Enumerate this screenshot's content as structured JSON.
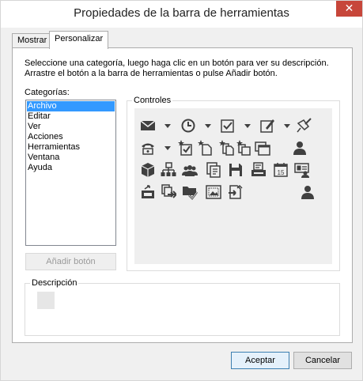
{
  "window": {
    "title": "Propiedades de la barra de herramientas",
    "close_glyph": "✕"
  },
  "tabs": [
    {
      "label": "Mostrar",
      "active": false
    },
    {
      "label": "Personalizar",
      "active": true
    }
  ],
  "instructions": {
    "line1": "Seleccione una categoría, luego haga clic en un botón para ver su descripción.",
    "line2": "Arrastre el botón a la barra de herramientas o pulse Añadir botón."
  },
  "categories": {
    "label": "Categorías:",
    "items": [
      "Archivo",
      "Editar",
      "Ver",
      "Acciones",
      "Herramientas",
      "Ventana",
      "Ayuda"
    ],
    "selected": "Archivo"
  },
  "add_button": {
    "label": "Añadir botón",
    "enabled": false
  },
  "controls": {
    "label": "Controles",
    "icons": [
      "mail-icon",
      "clock-icon",
      "checkbox-task-icon",
      "edit-check-icon",
      "pin-icon",
      "phone-icon",
      "new-task-icon",
      "new-page-icon",
      "new-copy-icon",
      "window-stack-icon",
      "contact-icon",
      "cube-icon",
      "network-icon",
      "group-icon",
      "notes-icon",
      "save-icon",
      "print-icon",
      "calendar-icon",
      "vcard-icon",
      "user-icon",
      "inbox-export-icon",
      "forward-pages-icon",
      "folder-check-icon",
      "frame-image-icon",
      "import-icon"
    ],
    "calendar_day": "15"
  },
  "description": {
    "label": "Descripción"
  },
  "buttons": {
    "accept": "Aceptar",
    "cancel": "Cancelar"
  },
  "colors": {
    "selection": "#3399ff",
    "close": "#c7463a",
    "icon": "#404040"
  }
}
